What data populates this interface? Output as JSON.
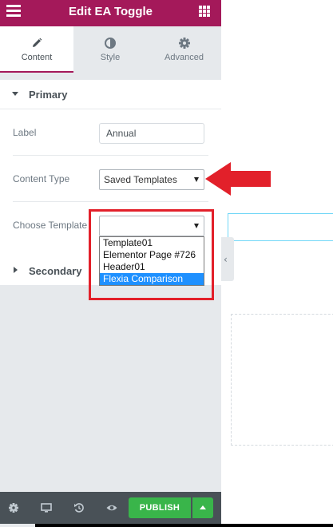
{
  "header": {
    "title": "Edit EA Toggle",
    "menu_icon": "hamburger-icon",
    "widgets_icon": "grid-icon"
  },
  "tabs": [
    {
      "label": "Content",
      "icon": "pencil-icon",
      "active": true
    },
    {
      "label": "Style",
      "icon": "half-circle-icon",
      "active": false
    },
    {
      "label": "Advanced",
      "icon": "gear-icon",
      "active": false
    }
  ],
  "sections": {
    "primary": {
      "title": "Primary",
      "expanded": true
    },
    "secondary": {
      "title": "Secondary",
      "expanded": false
    }
  },
  "controls": {
    "label": {
      "label": "Label",
      "value": "Annual"
    },
    "content_type": {
      "label": "Content Type",
      "value": "Saved Templates"
    },
    "choose_template": {
      "label": "Choose Template",
      "value": ""
    }
  },
  "dropdown": {
    "options": [
      "Template01",
      "Elementor Page #726",
      "Header01",
      "Flexia Comparison"
    ],
    "highlighted": "Flexia Comparison"
  },
  "footer": {
    "publish_label": "PUBLISH",
    "icons": [
      "settings-icon",
      "responsive-icon",
      "history-icon",
      "preview-icon"
    ]
  },
  "colors": {
    "brand": "#a4195a",
    "publish": "#39b54a",
    "annotation": "#e2202a",
    "highlight": "#1e90ff"
  }
}
